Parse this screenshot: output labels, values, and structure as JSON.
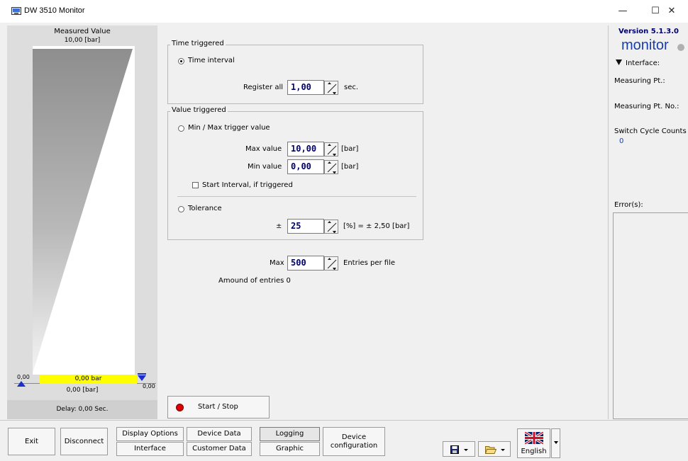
{
  "window": {
    "title": "DW 3510 Monitor"
  },
  "gauge": {
    "title": "Measured Value",
    "max_label": "10,00 [bar]",
    "min_left": "0,00",
    "min_right": "0,00",
    "bar_value": "0,00 bar",
    "current_value": "0,00 [bar]",
    "delay": "Delay: 0,00 Sec.",
    "fill_fraction": 0
  },
  "time_triggered": {
    "title": "Time triggered",
    "radio_label": "Time interval",
    "register_label": "Register all",
    "register_value": "1,00",
    "unit": "sec."
  },
  "value_triggered": {
    "title": "Value triggered",
    "minmax_label": "Min / Max trigger value",
    "max_label": "Max value",
    "max_value": "10,00",
    "max_unit": "[bar]",
    "min_label": "Min value",
    "min_value": "0,00",
    "min_unit": "[bar]",
    "start_interval_label": "Start Interval, if triggered",
    "tolerance_label": "Tolerance",
    "tolerance_sign": "±",
    "tolerance_value": "25",
    "tolerance_unit": "[%] = ± 2,50 [bar]"
  },
  "entries": {
    "max_label": "Max",
    "max_value": "500",
    "unit": "Entries per file",
    "amount_label": "Amound of entries 0"
  },
  "start_stop_label": "Start / Stop",
  "right_panel": {
    "version": "Version 5.1.3.0",
    "monitor_label": "monitor",
    "interface_label": "Interface:",
    "measuring_pt": "Measuring Pt.:",
    "measuring_pt_no": "Measuring Pt. No.:",
    "switch_cycle": "Switch Cycle Counts",
    "switch_cycle_value": "0",
    "errors_label": "Error(s):"
  },
  "bottom": {
    "exit": "Exit",
    "disconnect": "Disconnect",
    "display_options": "Display Options",
    "interface": "Interface",
    "device_data": "Device Data",
    "customer_data": "Customer Data",
    "logging": "Logging",
    "graphic": "Graphic",
    "device_config_1": "Device",
    "device_config_2": "configuration",
    "language": "English"
  },
  "colors": {
    "gauge_bar": "#ffff00",
    "record_led": "#dd0000",
    "monitor_text": "#1a3ea8",
    "value_text": "#00006a"
  }
}
